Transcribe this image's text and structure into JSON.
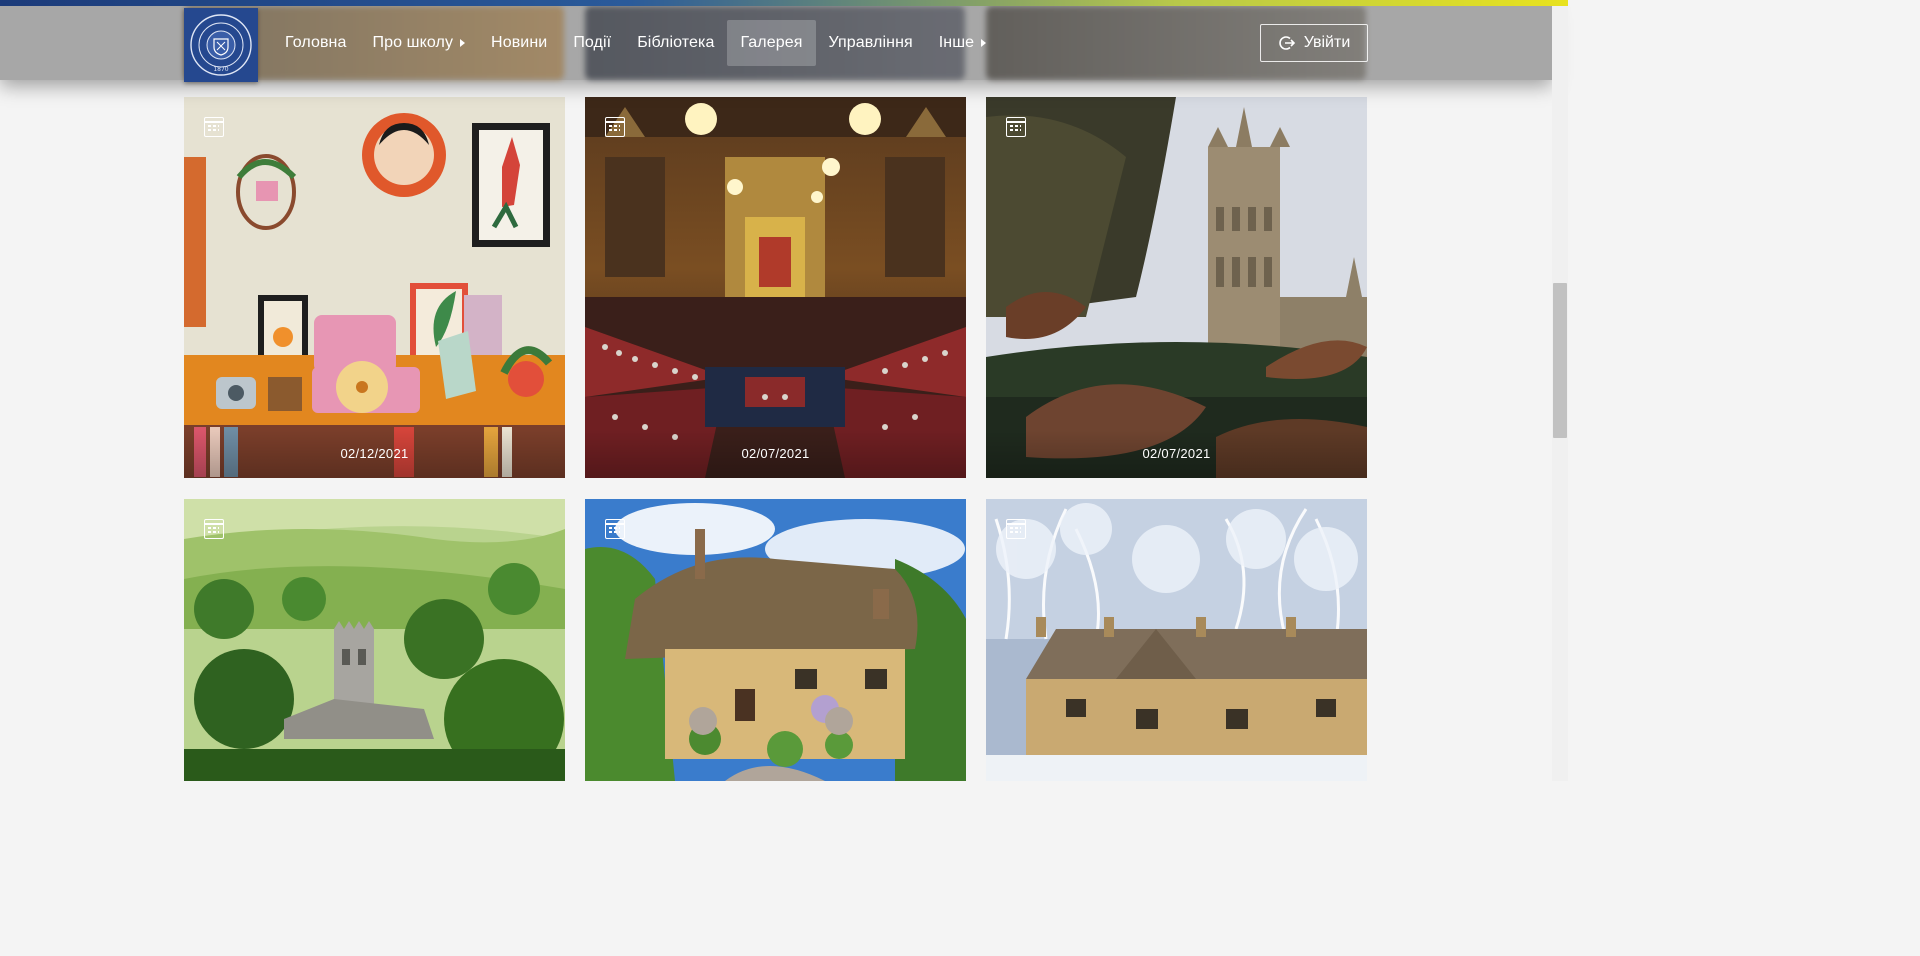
{
  "nav": {
    "items": [
      {
        "label": "Головна",
        "has_submenu": false,
        "active": false
      },
      {
        "label": "Про школу",
        "has_submenu": true,
        "active": false
      },
      {
        "label": "Новини",
        "has_submenu": false,
        "active": false
      },
      {
        "label": "Події",
        "has_submenu": false,
        "active": false
      },
      {
        "label": "Бібліотека",
        "has_submenu": false,
        "active": false
      },
      {
        "label": "Галерея",
        "has_submenu": false,
        "active": true
      },
      {
        "label": "Управління",
        "has_submenu": false,
        "active": false
      },
      {
        "label": "Інше",
        "has_submenu": true,
        "active": false
      }
    ],
    "login_label": "Увійти",
    "logo_text": "LOYOLA UNIVERSITY CHICAGO 1870"
  },
  "gallery": {
    "cards": [
      {
        "date": "02/12/2021",
        "icon": "calendar-icon"
      },
      {
        "date": "02/07/2021",
        "icon": "calendar-icon"
      },
      {
        "date": "02/07/2021",
        "icon": "calendar-icon"
      },
      {
        "date": "",
        "icon": "calendar-icon"
      },
      {
        "date": "",
        "icon": "calendar-icon"
      },
      {
        "date": "",
        "icon": "calendar-icon"
      }
    ]
  },
  "colors": {
    "header_bg": "#a0a0a0",
    "logo_bg": "#25488f",
    "top_stripe_start": "#1c3b7a",
    "top_stripe_end": "#e8e21e"
  }
}
